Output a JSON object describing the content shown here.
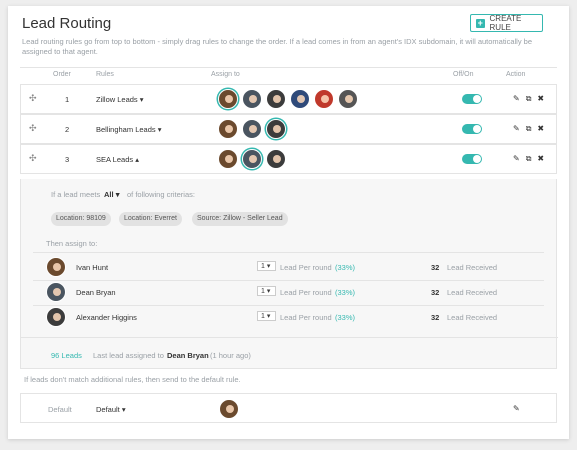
{
  "header": {
    "title": "Lead Routing",
    "create_button": "CREATE RULE",
    "description": "Lead routing rules go from top to bottom - simply drag rules to change the order. If a lead comes in from an agent's IDX subdomain, it will automatically be assigned to that agent."
  },
  "columns": {
    "order": "Order",
    "rules": "Rules",
    "assign_to": "Assign to",
    "off_on": "Off/On",
    "action": "Action"
  },
  "rules": [
    {
      "order": "1",
      "name": "Zillow Leads",
      "toggle_on": true
    },
    {
      "order": "2",
      "name": "Bellingham Leads",
      "toggle_on": true
    },
    {
      "order": "3",
      "name": "SEA Leads",
      "toggle_on": true
    }
  ],
  "expanded": {
    "criteria_prefix": "If a lead meets",
    "criteria_select": "All",
    "criteria_suffix": "of following criterias:",
    "tags": [
      "Location: 98109",
      "Location: Everret",
      "Source: Zillow - Seller Lead"
    ],
    "then_assign": "Then assign to:",
    "agents": [
      {
        "name": "Ivan Hunt",
        "per_round": "1",
        "per_round_label": "Lead Per round",
        "percent": "(33%)",
        "received": "32",
        "received_label": "Lead Received"
      },
      {
        "name": "Dean Bryan",
        "per_round": "1",
        "per_round_label": "Lead Per round",
        "percent": "(33%)",
        "received": "32",
        "received_label": "Lead Received"
      },
      {
        "name": "Alexander Higgins",
        "per_round": "1",
        "per_round_label": "Lead Per round",
        "percent": "(33%)",
        "received": "32",
        "received_label": "Lead Received"
      }
    ],
    "leads_count": "96 Leads",
    "last_assigned_prefix": "Last lead assigned to",
    "last_assigned_name": "Dean Bryan",
    "last_assigned_time": "(1 hour ago)"
  },
  "footer_note": "If leads don't match additional rules, then send to the default rule.",
  "default_rule": {
    "order": "Default",
    "name": "Default"
  },
  "colors": {
    "accent": "#35b8b0"
  },
  "icons": {
    "drag": "drag-handle-icon",
    "edit": "pencil-icon",
    "copy": "copy-icon",
    "delete": "close-icon",
    "plus": "plus-icon"
  }
}
